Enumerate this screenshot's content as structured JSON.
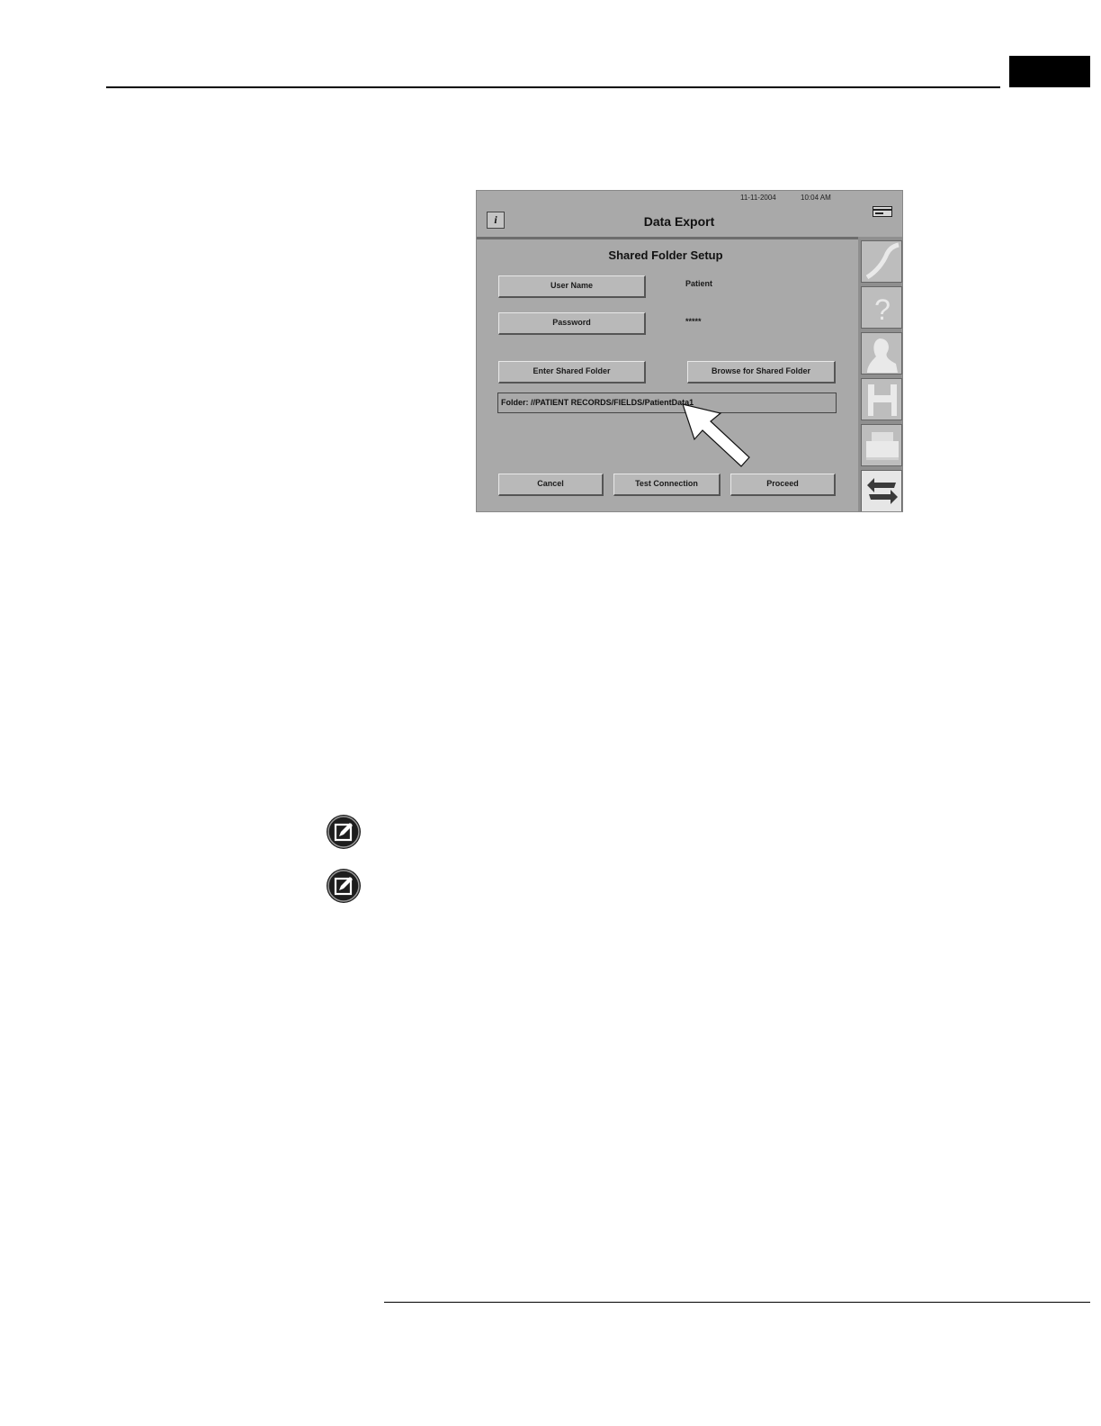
{
  "screen": {
    "date": "11-11-2004",
    "time": "10:04 AM",
    "info_label": "i",
    "title": "Data Export",
    "section_title": "Shared Folder Setup",
    "user_name_label": "User Name",
    "user_name_value": "Patient",
    "password_label": "Password",
    "password_value": "*****",
    "enter_folder_label": "Enter Shared Folder",
    "browse_folder_label": "Browse for Shared Folder",
    "folder_value": "Folder: //PATIENT RECORDS/FIELDS/PatientData1",
    "cancel_label": "Cancel",
    "test_label": "Test Connection",
    "proceed_label": "Proceed",
    "side_icons": [
      "curve-icon",
      "help-icon",
      "person-icon",
      "save-icon",
      "print-icon",
      "return-icon"
    ],
    "header_icon": "card-icon",
    "highlight_icon": "arrow-icon"
  },
  "notes": {
    "icons": [
      "note-icon",
      "note-icon"
    ]
  }
}
